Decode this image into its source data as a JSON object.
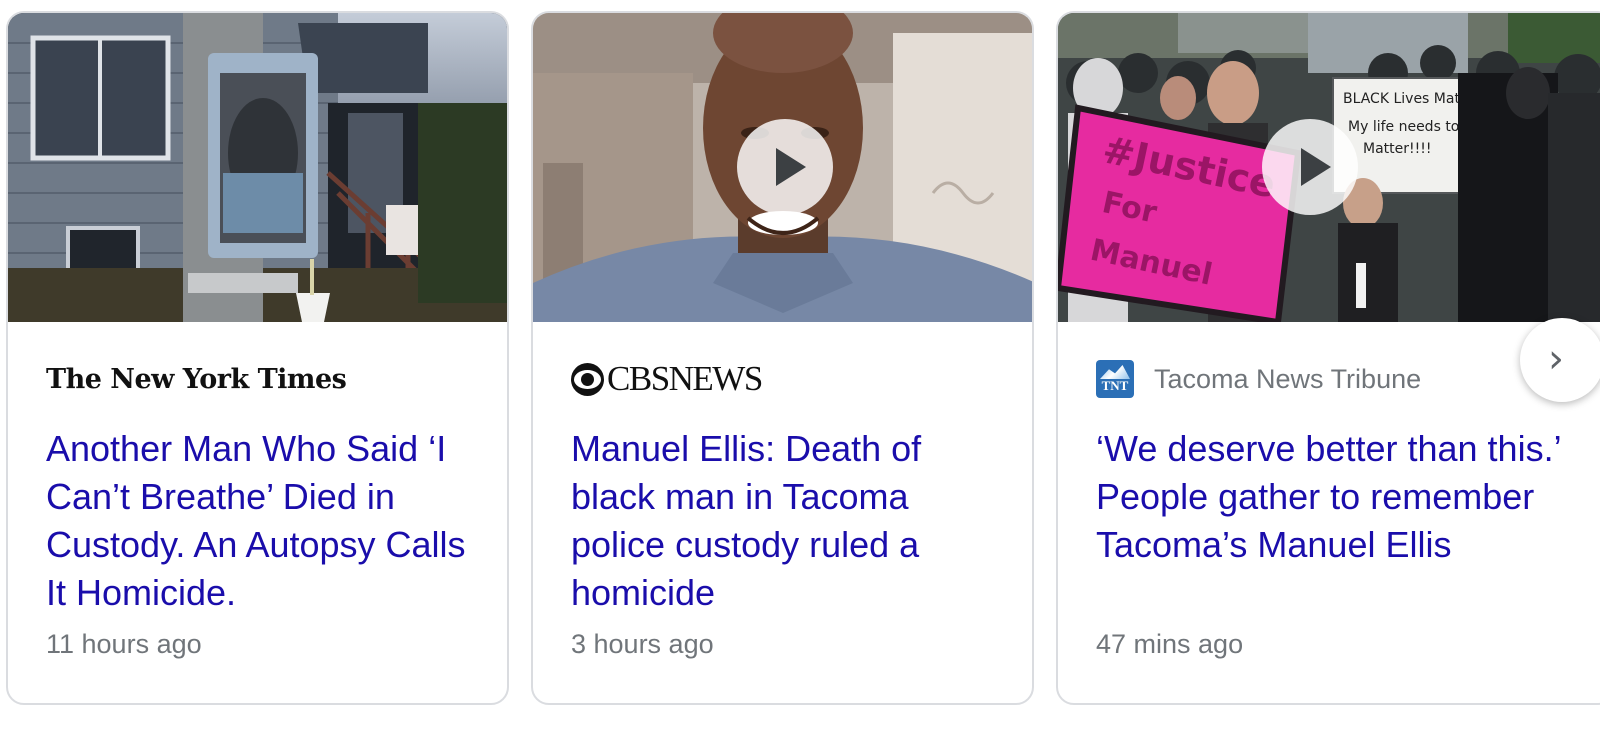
{
  "cards": [
    {
      "source": "The New York Times",
      "headline": "Another Man Who Said ‘I Can’t Breathe’ Died in Custody. An Autopsy Calls It Homicide.",
      "time": "11 hours ago",
      "has_video": false
    },
    {
      "source": "CBSNEWS",
      "headline": "Manuel Ellis: Death of black man in Tacoma police custody ruled a homicide",
      "time": "3 hours ago",
      "has_video": true
    },
    {
      "source": "Tacoma News Tribune",
      "source_badge": "TNT",
      "headline": "‘We deserve better than this.’ People gather to remember Tacoma’s Manuel Ellis",
      "time": "47 mins ago",
      "has_video": true
    }
  ],
  "protest_signs": {
    "pink_sign": "#Justice For Manuel",
    "white_sign": "Black Lives Matter My life needs to Matter!!!!"
  },
  "colors": {
    "headline": "#1a0dab",
    "meta_text": "#70757a",
    "card_border": "#dadce0",
    "sign_pink": "#e62ba0"
  },
  "icons": {
    "play": "play-icon",
    "next": "chevron-right-icon"
  }
}
